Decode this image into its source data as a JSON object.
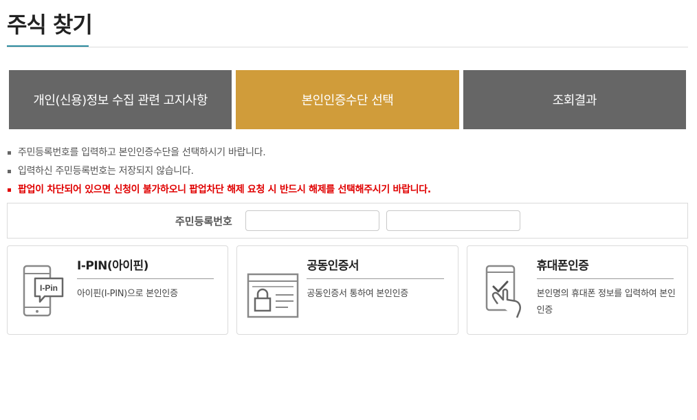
{
  "page": {
    "title": "주식 찾기"
  },
  "steps": [
    {
      "label": "개인(신용)정보 수집 관련 고지사항",
      "state": "inactive"
    },
    {
      "label": "본인인증수단 선택",
      "state": "active"
    },
    {
      "label": "조회결과",
      "state": "inactive"
    }
  ],
  "notices": [
    "주민등록번호를 입력하고 본인인증수단을 선택하시기 바랍니다.",
    "입력하신 주민등록번호는 저장되지 않습니다.",
    "팝업이 차단되어 있으면 신청이 불가하오니 팝업차단 해제 요청 시 반드시 해제를 선택해주시기 바랍니다."
  ],
  "ssn": {
    "label": "주민등록번호",
    "first_value": "",
    "second_value": ""
  },
  "methods": [
    {
      "title": "I-PIN(아이핀)",
      "desc": "아이핀(I-PIN)으로 본인인증",
      "icon": "ipin-phone-icon",
      "icon_text": "I-Pin"
    },
    {
      "title": "공동인증서",
      "desc": "공동인증서 통하여 본인인증",
      "icon": "certificate-lock-icon"
    },
    {
      "title": "휴대폰인증",
      "desc": "본인명의 휴대폰 정보를 입력하여 본인인증",
      "icon": "phone-check-icon"
    }
  ],
  "colors": {
    "accent_gold": "#d09c3a",
    "step_gray": "#666666",
    "warning_red": "#e00000",
    "title_underline": "#2a8a9e"
  }
}
